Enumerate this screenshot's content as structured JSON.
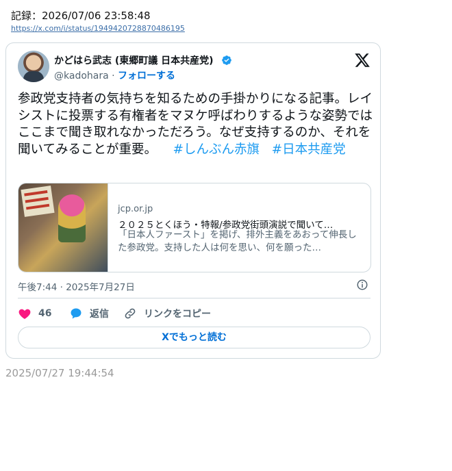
{
  "record": {
    "label": "記録：2026/07/06 23:58:48",
    "url": "https://x.com/i/status/1949420728870486195"
  },
  "tweet": {
    "author_name": "かどはら武志 (東郷町議 日本共産党)",
    "handle": "@kadohara",
    "separator": " · ",
    "follow_label": "フォローする",
    "text_main": "参政党支持者の気持ちを知るための手掛かりになる記事。レイシストに投票する有権者をマヌケ呼ばわりするような姿勢ではここまで聞き取れなかっただろう。なぜ支持するのか、それを聞いてみることが重要。",
    "hashtag_1": "#しんぶん赤旗",
    "hashtag_2": "#日本共産党",
    "timestamp": "午後7:44 · 2025年7月27日",
    "like_count": "46",
    "reply_label": "返信",
    "copy_link_label": "リンクをコピー",
    "read_more_label": "Xでもっと読む",
    "colors": {
      "link": "#1d9bf0",
      "follow": "#006fd6",
      "like": "#f91880",
      "verified": "#1d9bf0"
    }
  },
  "link_card": {
    "domain": "jcp.or.jp",
    "title": "２０２５とくほう・特報/参政党街頭演説で聞いて…",
    "description": "「日本人ファースト」を掲げ、排外主義をあおって伸長した参政党。支持した人は何を思い、何を願った…"
  },
  "footer": {
    "date": "2025/07/27 19:44:54"
  }
}
